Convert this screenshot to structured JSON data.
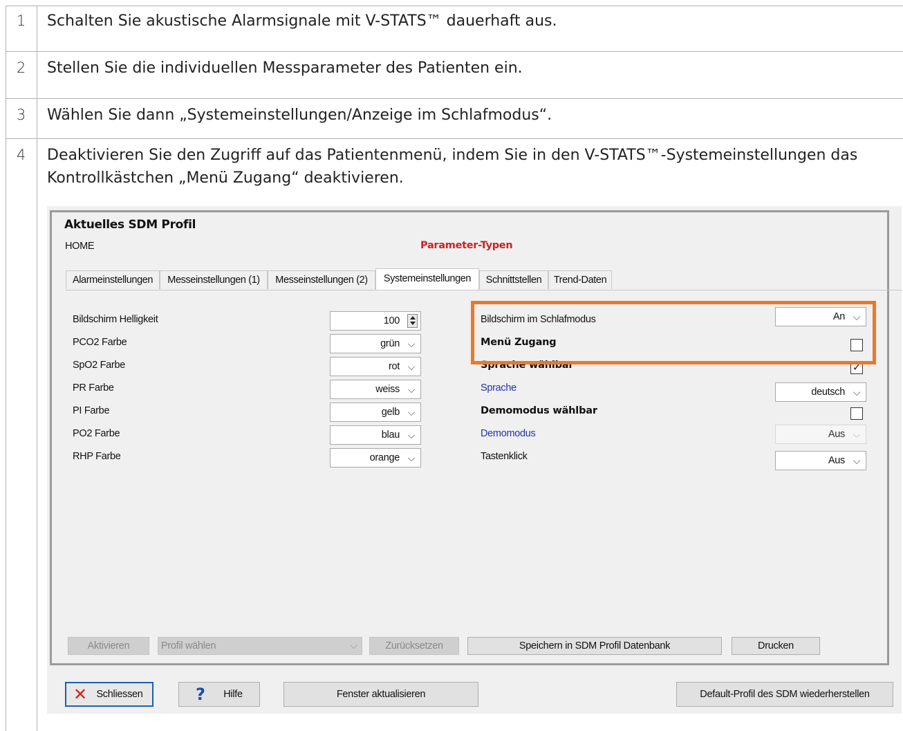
{
  "steps": [
    {
      "num": "1",
      "text": "Schalten Sie akustische Alarmsignale mit V-STATS™ dauerhaft aus."
    },
    {
      "num": "2",
      "text": "Stellen Sie die individuellen Messparameter des Patienten ein."
    },
    {
      "num": "3",
      "text": "Wählen Sie dann „Systemeinstellungen/Anzeige im Schlafmodus“."
    },
    {
      "num": "4",
      "text": "Deaktivieren Sie den Zugriff auf das Patientenmenü, indem Sie in den V-STATS™-Systemeinstellungen das Kontrollkästchen „Menü Zugang“ deaktivieren."
    }
  ],
  "app": {
    "title": "Aktuelles SDM Profil",
    "home": "HOME",
    "parameter_types": "Parameter-Typen",
    "tabs": [
      "Alarmeinstellungen",
      "Messeinstellungen (1)",
      "Messeinstellungen (2)",
      "Systemeinstellungen",
      "Schnittstellen",
      "Trend-Daten"
    ],
    "active_tab": "Systemeinstellungen",
    "left_settings": [
      {
        "label": "Bildschirm Helligkeit",
        "value": "100",
        "control": "spinner"
      },
      {
        "label": "PCO2 Farbe",
        "value": "grün",
        "control": "combo"
      },
      {
        "label": "SpO2 Farbe",
        "value": "rot",
        "control": "combo"
      },
      {
        "label": "PR Farbe",
        "value": "weiss",
        "control": "combo"
      },
      {
        "label": "PI Farbe",
        "value": "gelb",
        "control": "combo"
      },
      {
        "label": "PO2 Farbe",
        "value": "blau",
        "control": "combo"
      },
      {
        "label": "RHP Farbe",
        "value": "orange",
        "control": "combo"
      }
    ],
    "right_settings": {
      "sleep_screen": {
        "label": "Bildschirm im Schlafmodus",
        "value": "An"
      },
      "menu_access": {
        "label": "Menü Zugang",
        "checked": false
      },
      "language_selectable": {
        "label": "Sprache wählbar",
        "checked": true
      },
      "language": {
        "label": "Sprache",
        "value": "deutsch"
      },
      "demo_selectable": {
        "label": "Demomodus wählbar",
        "checked": false
      },
      "demo_mode": {
        "label": "Demomodus",
        "value": "Aus"
      },
      "key_click": {
        "label": "Tastenklick",
        "value": "Aus"
      }
    },
    "bottom_buttons": {
      "activate": "Aktivieren",
      "profile_select": "Profil wählen",
      "reset": "Zurücksetzen",
      "save": "Speichern in SDM Profil Datenbank",
      "print": "Drucken"
    },
    "footer_buttons": {
      "close": "Schliessen",
      "help": "Hilfe",
      "refresh": "Fenster aktualisieren",
      "default_profile": "Default-Profil des SDM wiederherstellen"
    },
    "colors": {
      "highlight": "#e8792b",
      "param_red": "#cc2222",
      "link_blue": "#2233aa",
      "help_blue": "#1a4fa8",
      "close_red": "#d42020"
    }
  }
}
